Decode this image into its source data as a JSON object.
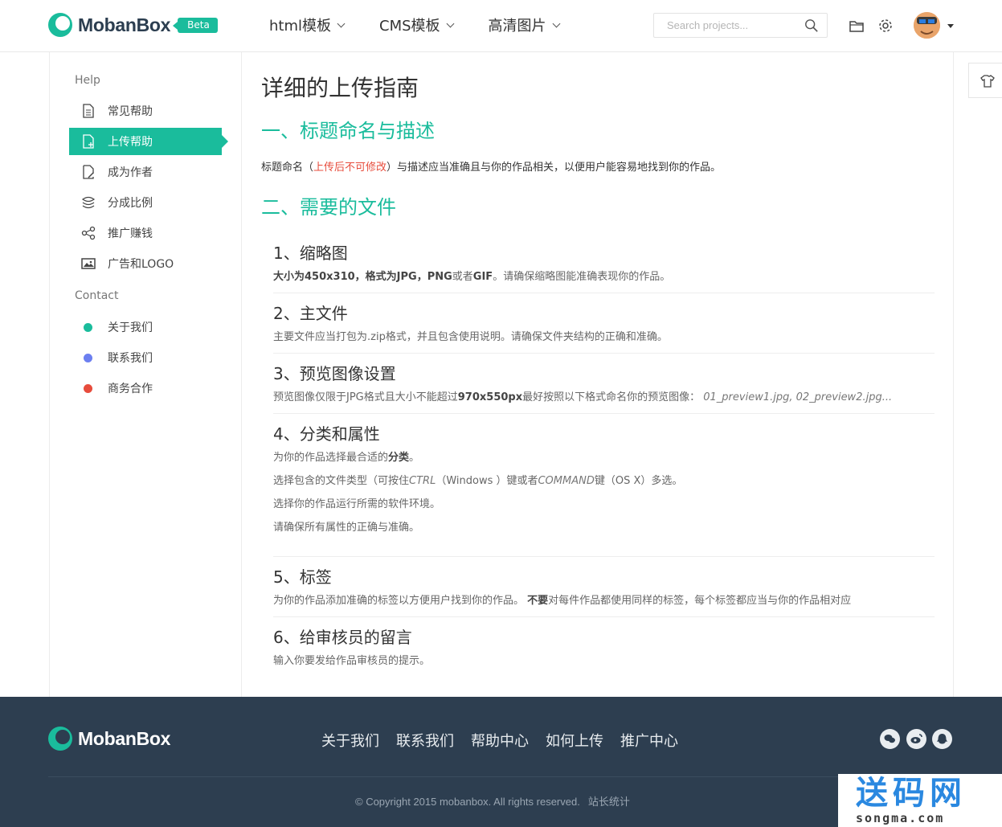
{
  "header": {
    "brand": "MobanBox",
    "badge": "Beta",
    "nav": [
      {
        "label": "html模板"
      },
      {
        "label": "CMS模板"
      },
      {
        "label": "高清图片"
      }
    ],
    "search_placeholder": "Search projects...",
    "icons": [
      "folder-icon",
      "gear-icon",
      "search-icon",
      "user-avatar",
      "caret-down-icon"
    ]
  },
  "sidebar": {
    "help_heading": "Help",
    "help_items": [
      {
        "label": "常见帮助",
        "icon": "document-icon"
      },
      {
        "label": "上传帮助",
        "icon": "upload-document-icon",
        "active": true
      },
      {
        "label": "成为作者",
        "icon": "edit-document-icon"
      },
      {
        "label": "分成比例",
        "icon": "stack-icon"
      },
      {
        "label": "推广赚钱",
        "icon": "share-icon"
      },
      {
        "label": "广告和LOGO",
        "icon": "image-icon"
      }
    ],
    "contact_heading": "Contact",
    "contact_items": [
      {
        "label": "关于我们",
        "color": "#1abc9c"
      },
      {
        "label": "联系我们",
        "color": "#6c7ff0"
      },
      {
        "label": "商务合作",
        "color": "#e74c3c"
      }
    ]
  },
  "main": {
    "title": "详细的上传指南",
    "section1_title": "一、标题命名与描述",
    "intro_before": "标题命名（",
    "intro_warn": "上传后不可修改",
    "intro_after": "）与描述应当准确且与你的作品相关，以便用户能容易地找到你的作品。",
    "section2_title": "二、需要的文件",
    "items": [
      {
        "title": "1、缩略图",
        "desc_parts": [
          "大小为450x310，格式为JPG，PNG",
          "或者",
          "GIF",
          "。请确保缩略图能准确表现你的作品。"
        ]
      },
      {
        "title": "2、主文件",
        "desc": "主要文件应当打包为.zip格式，并且包含使用说明。请确保文件夹结构的正确和准确。"
      },
      {
        "title": "3、预览图像设置",
        "desc_before": "预览图像仅限于JPG格式且大小不能超过",
        "desc_bold": "970x550px",
        "desc_after": "最好按照以下格式命名你的预览图像：",
        "desc_italic": "01_preview1.jpg, 02_preview2.jpg..."
      },
      {
        "title": "4、分类和属性",
        "line1_before": "为你的作品选择最合适的",
        "line1_bold": "分类",
        "line1_after": "。",
        "line2_before": "选择包含的文件类型（可按住",
        "line2_i1": "CTRL",
        "line2_mid": "（Windows ）键或者",
        "line2_i2": "COMMAND",
        "line2_after": "键（OS X）多选。",
        "line3": "选择你的作品运行所需的软件环境。",
        "line4": "请确保所有属性的正确与准确。"
      },
      {
        "title": "5、标签",
        "desc_before": "为你的作品添加准确的标签以方便用户找到你的作品。 ",
        "desc_bold": "不要",
        "desc_after": "对每件作品都使用同样的标签，每个标签都应当与你的作品相对应"
      },
      {
        "title": "6、给审核员的留言",
        "desc": "输入你要发给作品审核员的提示。"
      }
    ]
  },
  "footer": {
    "brand": "MobanBox",
    "links": [
      "关于我们",
      "联系我们",
      "帮助中心",
      "如何上传",
      "推广中心"
    ],
    "social": [
      "wechat-icon",
      "weibo-icon",
      "qq-icon"
    ],
    "copyright": "© Copyright 2015 mobanbox. All rights reserved.",
    "stats_link": "站长统计"
  },
  "watermark": {
    "title": "送码网",
    "sub": "songma.com"
  },
  "colors": {
    "accent": "#1abc9c",
    "footer_bg": "#2d3e50",
    "warning": "#e74c3c"
  }
}
